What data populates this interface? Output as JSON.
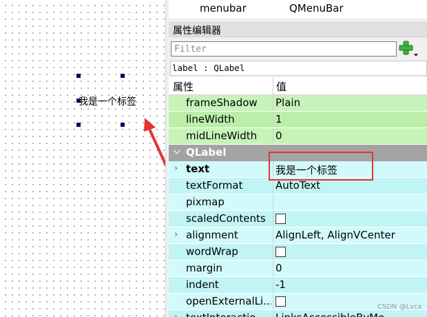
{
  "canvas": {
    "label_text": "我是一个标签"
  },
  "object_row": {
    "name": "menubar",
    "class": "QMenuBar"
  },
  "property_editor": {
    "title": "属性编辑器",
    "filter_placeholder": "Filter",
    "object_caption": "label : QLabel",
    "columns": {
      "property": "属性",
      "value": "值"
    },
    "frame_props": [
      {
        "name": "frameShadow",
        "value": "Plain"
      },
      {
        "name": "lineWidth",
        "value": "1"
      },
      {
        "name": "midLineWidth",
        "value": "0"
      }
    ],
    "section": "QLabel",
    "label_props": [
      {
        "name": "text",
        "value": "我是一个标签"
      },
      {
        "name": "textFormat",
        "value": "AutoText"
      },
      {
        "name": "pixmap",
        "value": ""
      },
      {
        "name": "scaledContents",
        "value": ""
      },
      {
        "name": "alignment",
        "value": "AlignLeft, AlignVCenter"
      },
      {
        "name": "wordWrap",
        "value": ""
      },
      {
        "name": "margin",
        "value": "0"
      },
      {
        "name": "indent",
        "value": "-1"
      },
      {
        "name": "openExternalLi...",
        "value": ""
      },
      {
        "name": "textInteractio...",
        "value": "LinksAccessibleByMo..."
      }
    ]
  },
  "watermark": "CSDN @Lvcx",
  "colors": {
    "annotation_red": "#e53333",
    "frame_rows_green": "#c7f3b9",
    "label_rows_cyan": "#d2fafa",
    "section_gray": "#a3a3a3",
    "selection_handle": "#00006e"
  }
}
